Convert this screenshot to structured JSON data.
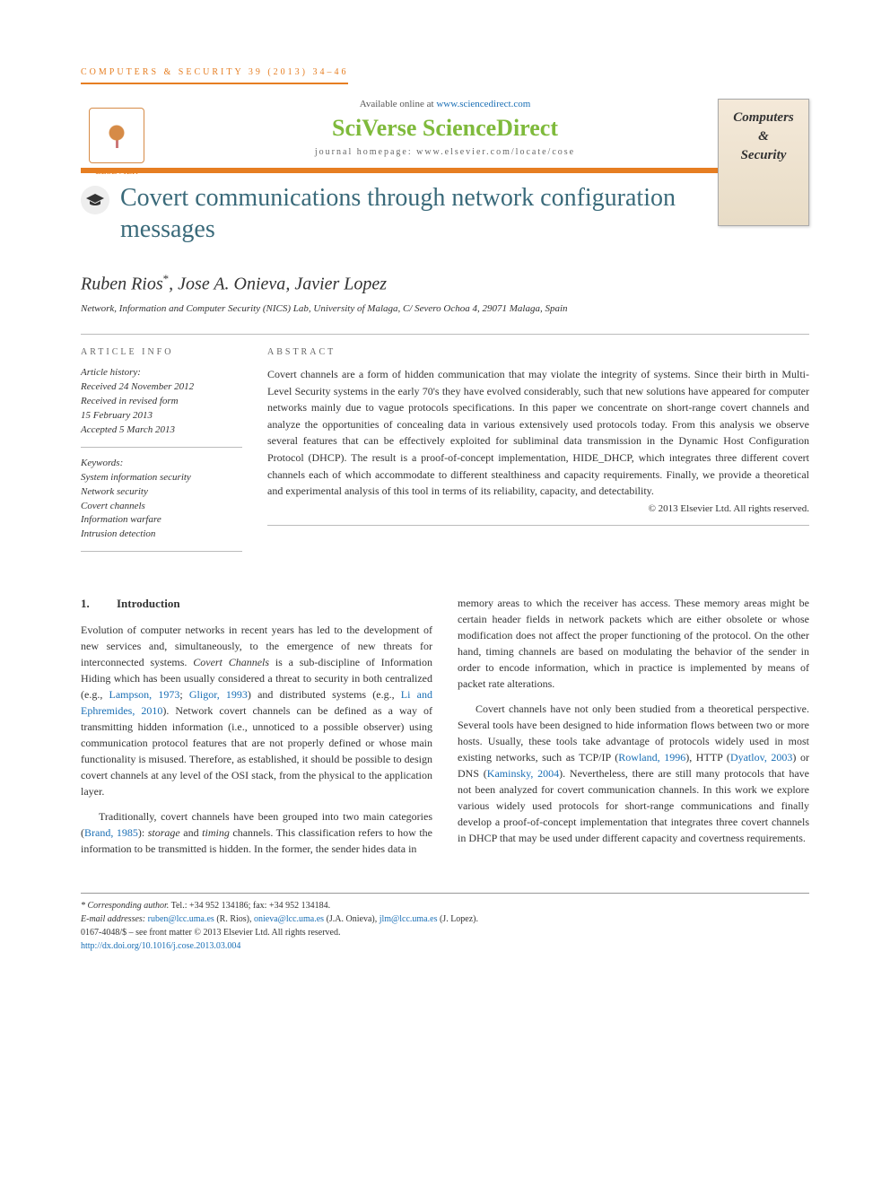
{
  "journal_ref": "COMPUTERS & SECURITY 39 (2013) 34–46",
  "header": {
    "available": "Available online at ",
    "available_link": "www.sciencedirect.com",
    "brand": "SciVerse ScienceDirect",
    "homepage_label": "journal homepage: ",
    "homepage_url": "www.elsevier.com/locate/cose",
    "publisher": "ELSEVIER",
    "journal_cover": [
      "Computers",
      "&",
      "Security"
    ],
    "crossmark": "CrossMark"
  },
  "title": "Covert communications through network configuration messages",
  "authors": "Ruben Rios*, Jose A. Onieva, Javier Lopez",
  "affiliation": "Network, Information and Computer Security (NICS) Lab, University of Malaga, C/ Severo Ochoa 4, 29071 Malaga, Spain",
  "info_head": "ARTICLE INFO",
  "abstract_head": "ABSTRACT",
  "history": {
    "label": "Article history:",
    "received": "Received 24 November 2012",
    "revised_a": "Received in revised form",
    "revised_b": "15 February 2013",
    "accepted": "Accepted 5 March 2013"
  },
  "keywords": {
    "label": "Keywords:",
    "items": [
      "System information security",
      "Network security",
      "Covert channels",
      "Information warfare",
      "Intrusion detection"
    ]
  },
  "abstract": "Covert channels are a form of hidden communication that may violate the integrity of systems. Since their birth in Multi-Level Security systems in the early 70's they have evolved considerably, such that new solutions have appeared for computer networks mainly due to vague protocols specifications. In this paper we concentrate on short-range covert channels and analyze the opportunities of concealing data in various extensively used protocols today. From this analysis we observe several features that can be effectively exploited for subliminal data transmission in the Dynamic Host Configuration Protocol (DHCP). The result is a proof-of-concept implementation, HIDE_DHCP, which integrates three different covert channels each of which accommodate to different stealthiness and capacity requirements. Finally, we provide a theoretical and experimental analysis of this tool in terms of its reliability, capacity, and detectability.",
  "copyright": "© 2013 Elsevier Ltd. All rights reserved.",
  "section1": {
    "num": "1.",
    "title": "Introduction"
  },
  "body": {
    "p1a": "Evolution of computer networks in recent years has led to the development of new services and, simultaneously, to the emergence of new threats for interconnected systems. ",
    "p1b_em": "Covert Channels",
    "p1c": " is a sub-discipline of Information Hiding which has been usually considered a threat to security in both centralized (e.g., ",
    "ref1": "Lampson, 1973",
    "p1d": "; ",
    "ref2": "Gligor, 1993",
    "p1e": ") and distributed systems (e.g., ",
    "ref3": "Li and Ephremides, 2010",
    "p1f": "). Network covert channels can be defined as a way of transmitting hidden information (i.e., unnoticed to a possible observer) using communication protocol features that are not properly defined or whose main functionality is misused. Therefore, as established, it should be possible to design covert channels at any level of the OSI stack, from the physical to the application layer.",
    "p2a": "Traditionally, covert channels have been grouped into two main categories (",
    "ref4": "Brand, 1985",
    "p2b": "): ",
    "p2_em1": "storage",
    "p2c": " and ",
    "p2_em2": "timing",
    "p2d": " channels. This classification refers to how the information to be transmitted is hidden. In the former, the sender hides data in ",
    "p2e": "memory areas to which the receiver has access. These memory areas might be certain header fields in network packets which are either obsolete or whose modification does not affect the proper functioning of the protocol. On the other hand, timing channels are based on modulating the behavior of the sender in order to encode information, which in practice is implemented by means of packet rate alterations.",
    "p3a": "Covert channels have not only been studied from a theoretical perspective. Several tools have been designed to hide information flows between two or more hosts. Usually, these tools take advantage of protocols widely used in most existing networks, such as TCP/IP (",
    "ref5": "Rowland, 1996",
    "p3b": "), HTTP (",
    "ref6": "Dyatlov, 2003",
    "p3c": ") or DNS (",
    "ref7": "Kaminsky, 2004",
    "p3d": "). Nevertheless, there are still many protocols that have not been analyzed for covert communication channels. In this work we explore various widely used protocols for short-range communications and finally develop a proof-of-concept implementation that integrates three covert channels in DHCP that may be used under different capacity and covertness requirements."
  },
  "footnote": {
    "corr_label": "* Corresponding author.",
    "tel": " Tel.: +34 952 134186; fax: +34 952 134184.",
    "email_label": "E-mail addresses: ",
    "e1": "ruben@lcc.uma.es",
    "n1": " (R. Rios), ",
    "e2": "onieva@lcc.uma.es",
    "n2": " (J.A. Onieva), ",
    "e3": "jlm@lcc.uma.es",
    "n3": " (J. Lopez).",
    "issn": "0167-4048/$ – see front matter © 2013 Elsevier Ltd. All rights reserved.",
    "doi": "http://dx.doi.org/10.1016/j.cose.2013.03.004"
  }
}
